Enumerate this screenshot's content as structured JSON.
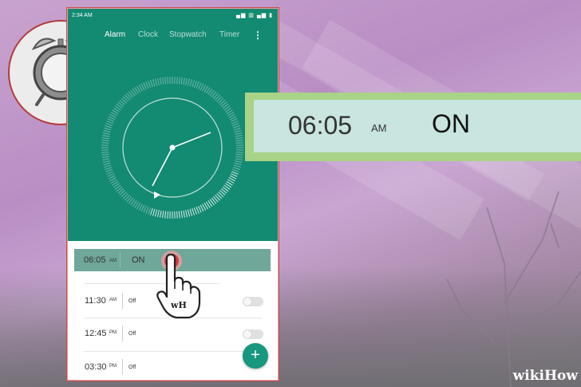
{
  "statusbar": {
    "time": "2:34 AM",
    "icons_text": "▄▆ ▥ ▄▆ ▮"
  },
  "tabs": [
    {
      "label": "Alarm",
      "active": true
    },
    {
      "label": "Clock",
      "active": false
    },
    {
      "label": "Stopwatch",
      "active": false
    },
    {
      "label": "Timer",
      "active": false
    }
  ],
  "menu_icon": "more-vertical-icon",
  "alarms": [
    {
      "time": "06:05",
      "ampm": "AM",
      "state": "ON",
      "selected": true
    },
    {
      "time": "11:30",
      "ampm": "AM",
      "state": "Off",
      "selected": false
    },
    {
      "time": "12:45",
      "ampm": "PM",
      "state": "Off",
      "selected": false
    },
    {
      "time": "03:30",
      "ampm": "PM",
      "state": "Off",
      "selected": false
    }
  ],
  "fab_label": "+",
  "hand_badge": "wH",
  "callout": {
    "time": "06:05",
    "ampm": "AM",
    "state": "ON"
  },
  "watermark": {
    "part1": "wiki",
    "part2": "How"
  },
  "colors": {
    "teal": "#138a72",
    "selected_row": "#6fa79a",
    "tap_red": "#d33a3a",
    "callout_border": "#a9d387",
    "callout_fill": "#c8e5df"
  }
}
